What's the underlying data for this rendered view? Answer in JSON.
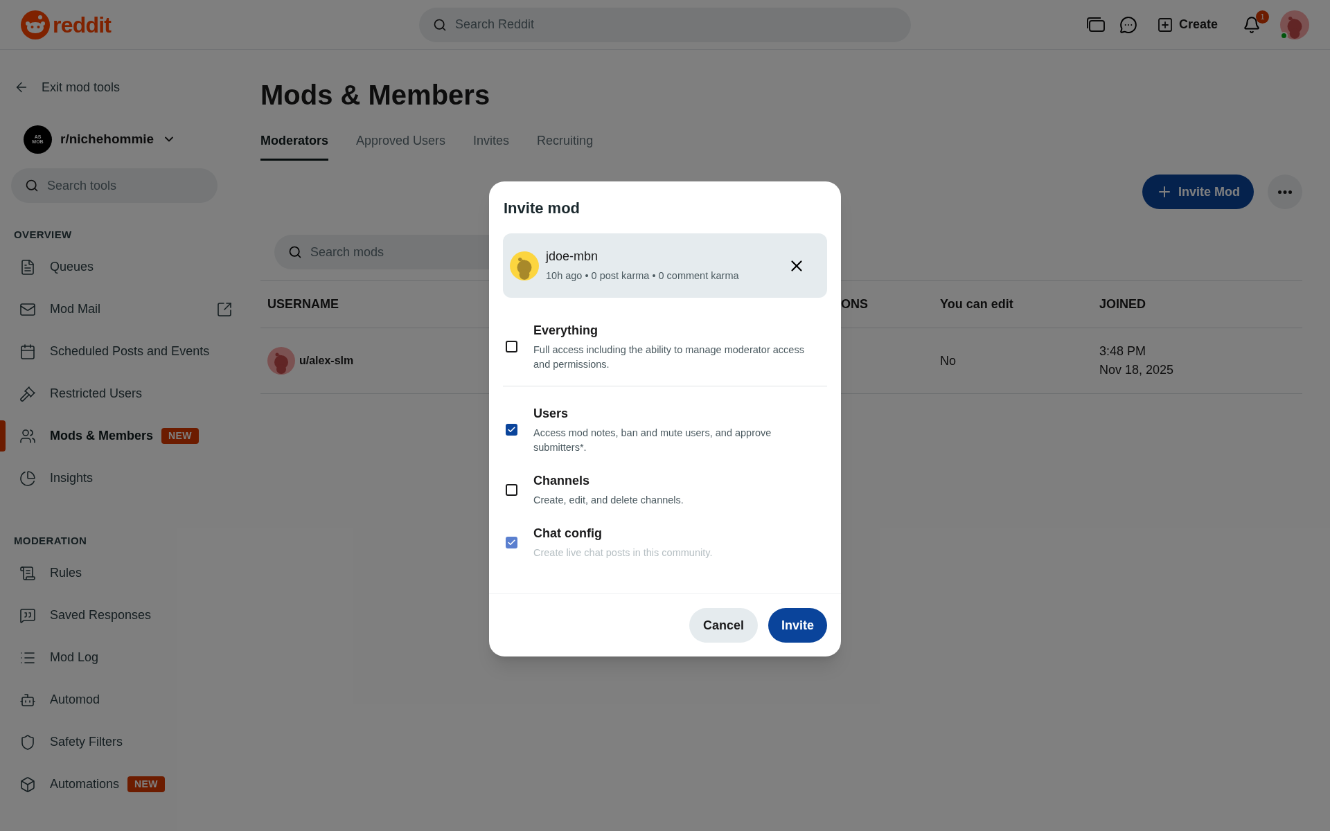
{
  "header": {
    "logo_text": "reddit",
    "search": {
      "placeholder": "Search Reddit"
    },
    "create": "Create",
    "notification_count": "1"
  },
  "sidebar": {
    "exit": "Exit mod tools",
    "community": {
      "name": "r/nichehommie",
      "avatar_lines": [
        "AS",
        "MOB"
      ]
    },
    "search": {
      "placeholder": "Search tools"
    },
    "sections": [
      {
        "title": "OVERVIEW",
        "items": [
          {
            "label": "Queues",
            "selected": false,
            "external": false
          },
          {
            "label": "Mod Mail",
            "selected": false,
            "external": true
          },
          {
            "label": "Scheduled Posts and Events",
            "selected": false,
            "external": false
          },
          {
            "label": "Restricted Users",
            "selected": false,
            "external": false
          },
          {
            "label": "Mods & Members",
            "selected": true,
            "external": false,
            "badge": "NEW"
          },
          {
            "label": "Insights",
            "selected": false,
            "external": false
          }
        ]
      },
      {
        "title": "MODERATION",
        "items": [
          {
            "label": "Rules",
            "selected": false,
            "external": false
          },
          {
            "label": "Saved Responses",
            "selected": false,
            "external": false
          },
          {
            "label": "Mod Log",
            "selected": false,
            "external": false
          },
          {
            "label": "Automod",
            "selected": false,
            "external": false
          },
          {
            "label": "Safety Filters",
            "selected": false,
            "external": false
          },
          {
            "label": "Automations",
            "selected": false,
            "external": false,
            "badge": "NEW"
          }
        ]
      }
    ]
  },
  "main": {
    "title": "Mods & Members",
    "tabs": [
      {
        "label": "Moderators",
        "selected": true
      },
      {
        "label": "Approved Users",
        "selected": false
      },
      {
        "label": "Invites",
        "selected": false
      },
      {
        "label": "Recruiting",
        "selected": false
      }
    ],
    "invite_button": "Invite Mod",
    "search": {
      "placeholder": "Search mods"
    },
    "table": {
      "columns": [
        "USERNAME",
        "ONS",
        "You can edit",
        "JOINED"
      ],
      "rows": [
        {
          "username": "u/alex-slm",
          "can_edit": "No",
          "joined": [
            "3:48 PM",
            "Nov 18, 2025"
          ]
        }
      ]
    }
  },
  "modal": {
    "title": "Invite mod",
    "user": {
      "name": "jdoe-mbn",
      "meta": "10h ago • 0 post karma • 0 comment karma"
    },
    "permissions": [
      {
        "name": "Everything",
        "description": "Full access including the ability to manage moderator access and permissions.",
        "checked": false
      },
      {
        "name": "Users",
        "description": "Access mod notes, ban and mute users, and approve submitters*.",
        "checked": true
      },
      {
        "name": "Channels",
        "description": "Create, edit, and delete channels.",
        "checked": false
      },
      {
        "name": "Chat config",
        "description": "Create live chat posts in this community.",
        "checked": true
      }
    ],
    "cancel": "Cancel",
    "invite": "Invite"
  }
}
